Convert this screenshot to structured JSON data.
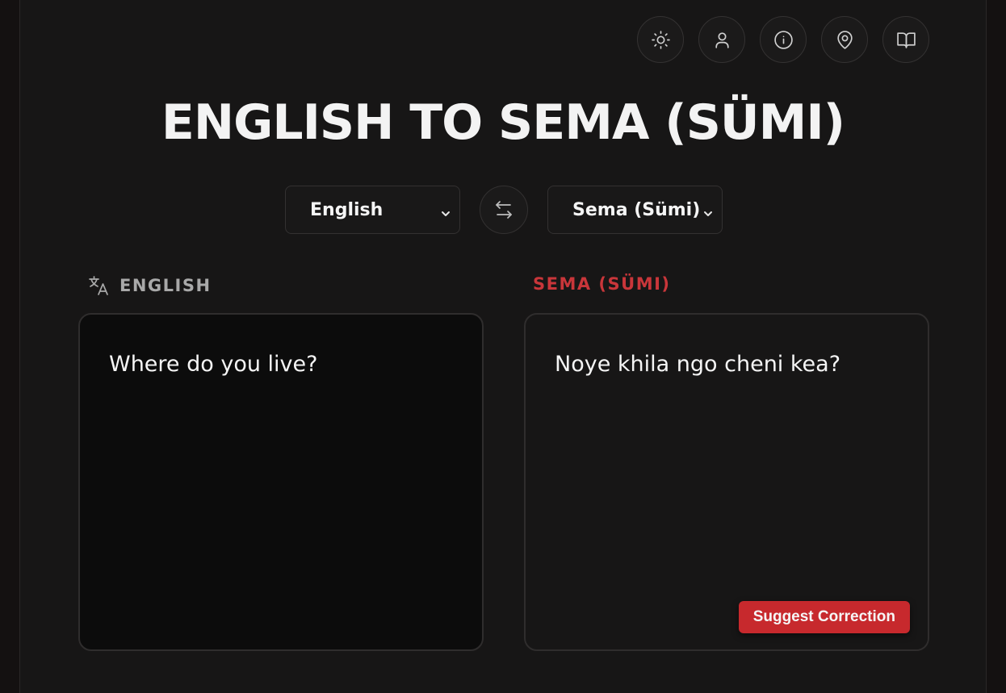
{
  "header": {
    "title": "ENGLISH TO SEMA (SÜMI)",
    "toolbar": [
      {
        "icon": "sun-icon",
        "label": "Theme"
      },
      {
        "icon": "user-icon",
        "label": "Profile"
      },
      {
        "icon": "info-icon",
        "label": "About"
      },
      {
        "icon": "map-pin-icon",
        "label": "Location"
      },
      {
        "icon": "book-open-icon",
        "label": "Dictionary"
      }
    ]
  },
  "languages": {
    "source_selected": "English",
    "target_selected": "Sema (Sümi)"
  },
  "source_panel": {
    "label": "ENGLISH",
    "text": "Where do you live?"
  },
  "target_panel": {
    "label": "SEMA (SÜMI)",
    "text": "Noye khila ngo cheni kea?",
    "suggest_label": "Suggest Correction"
  },
  "colors": {
    "accent": "#c7292d",
    "background": "#171616",
    "source_box": "#0c0c0c",
    "border": "#2f2d2d"
  }
}
